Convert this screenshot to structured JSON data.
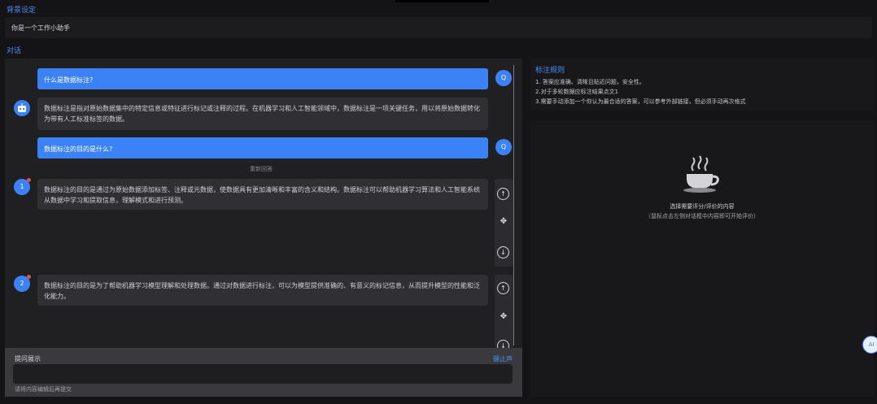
{
  "system_section": {
    "title": "背景设定",
    "value": "你是一个工作小助手"
  },
  "dialog_section": {
    "title": "对话"
  },
  "messages": {
    "user_1": "什么是数据标注?",
    "user_avatar_glyph": "Q",
    "ai_1": "数据标注是指对原始数据集中的特定信息或特征进行标记或注释的过程。在机器学习和人工智能领域中，数据标注是一项关键任务，用以将原始数据转化为带有人工标准标签的数据。",
    "user_2": "数据标注的目的是什么?",
    "regen_note": "重新回答",
    "answer_1_index": "1",
    "answer_1": "数据标注的目的是通过为原始数据添加标签、注释或元数据，使数据具有更加清晰和丰富的含义和结构。数据标注可以帮助机器学习算法和人工智能系统从数据中学习和提取信息，理解模式和进行预测。",
    "answer_2_index": "2",
    "answer_2": "数据标注的目的是为了帮助机器学习模型理解和处理数据。通过对数据进行标注，可以为模型提供准确的、有意义的标记信息，从而提升模型的性能和泛化能力。"
  },
  "controls": {
    "up": "↑",
    "move": "✥",
    "down": "↓"
  },
  "input": {
    "label": "提问展示",
    "link": "键止声",
    "value": "",
    "hint": "请将内容编辑后再提交"
  },
  "rules": {
    "title": "标注规则",
    "items": [
      "1. 答案应准确、清晰且贴近问题，安全性。",
      "2.对于多轮数据应标注结果点文1",
      "3.需要手动添加一个你认为最合适的答案，可以参考外部链接，但必须手动再次格式"
    ]
  },
  "empty_state": {
    "line1": "选择需要评分/评价的内容",
    "line2": "（鼠标点击左侧对话框中内容即可开始评价）",
    "icon": "coffee-cup-icon"
  },
  "ai_badge": "AI",
  "colors": {
    "accent": "#3b82f6",
    "link": "#4a8ef5",
    "background": "#141416"
  }
}
